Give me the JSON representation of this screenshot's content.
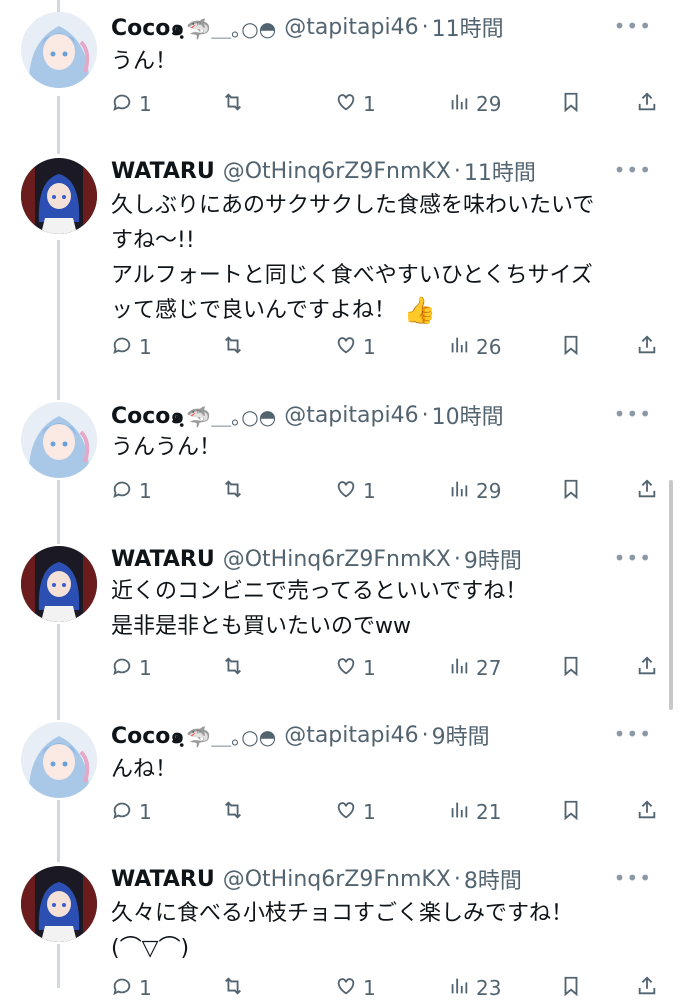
{
  "tweets": [
    {
      "name": "Coco๑ฺ",
      "deco": "🦈＿｡○◓",
      "handle": "@tapitapi46",
      "time": "11時間",
      "text": "うん！",
      "counts": {
        "reply": "1",
        "retweet": "",
        "like": "1",
        "views": "29"
      }
    },
    {
      "name": "WATARU",
      "deco": "",
      "handle": "@OtHinq6rZ9FnmKX",
      "time": "11時間",
      "text": "久しぶりにあのサクサクした食感を味わいたいで\nすね〜!!\nアルフォートと同じく食べやすいひとくちサイズ\nッて感じで良いんですよね！",
      "emoji": "👍",
      "counts": {
        "reply": "1",
        "retweet": "",
        "like": "1",
        "views": "26"
      }
    },
    {
      "name": "Coco๑ฺ",
      "deco": "🦈＿｡○◓",
      "handle": "@tapitapi46",
      "time": "10時間",
      "text": "うんうん！",
      "counts": {
        "reply": "1",
        "retweet": "",
        "like": "1",
        "views": "29"
      }
    },
    {
      "name": "WATARU",
      "deco": "",
      "handle": "@OtHinq6rZ9FnmKX",
      "time": "9時間",
      "text": "近くのコンビニで売ってるといいですね！\n是非是非とも買いたいのでww",
      "counts": {
        "reply": "1",
        "retweet": "",
        "like": "1",
        "views": "27"
      }
    },
    {
      "name": "Coco๑ฺ",
      "deco": "🦈＿｡○◓",
      "handle": "@tapitapi46",
      "time": "9時間",
      "text": "んね！",
      "counts": {
        "reply": "1",
        "retweet": "",
        "like": "1",
        "views": "21"
      }
    },
    {
      "name": "WATARU",
      "deco": "",
      "handle": "@OtHinq6rZ9FnmKX",
      "time": "8時間",
      "text": "久々に食べる小枝チョコすごく楽しみですね！\n(⌒▽⌒)",
      "counts": {
        "reply": "1",
        "retweet": "",
        "like": "1",
        "views": "23"
      }
    }
  ],
  "separator": "·",
  "more_label": "•••",
  "icons": {
    "reply": "reply-icon",
    "retweet": "retweet-icon",
    "like": "heart-icon",
    "views": "views-chart-icon",
    "bookmark": "bookmark-icon",
    "share": "share-icon"
  },
  "colors": {
    "text": "#0f1419",
    "secondary": "#536471",
    "thread_line": "#cfd9de"
  }
}
